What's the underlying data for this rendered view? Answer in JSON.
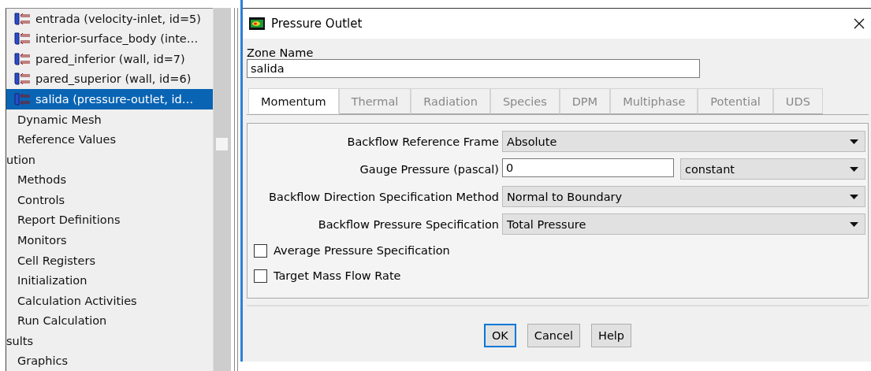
{
  "tree": {
    "items": [
      {
        "label": "entrada (velocity-inlet, id=5)",
        "kind": "zone",
        "selected": false
      },
      {
        "label": "interior-surface_body (inte…",
        "kind": "zone",
        "selected": false
      },
      {
        "label": "pared_inferior (wall, id=7)",
        "kind": "zone",
        "selected": false
      },
      {
        "label": "pared_superior (wall, id=6)",
        "kind": "zone",
        "selected": false
      },
      {
        "label": "salida (pressure-outlet, id…",
        "kind": "zone",
        "selected": true
      },
      {
        "label": "Dynamic Mesh",
        "kind": "item",
        "selected": false
      },
      {
        "label": "Reference Values",
        "kind": "item",
        "selected": false
      },
      {
        "label": "ution",
        "kind": "section",
        "selected": false,
        "children": [
          {
            "label": "Methods",
            "kind": "item",
            "selected": false
          },
          {
            "label": "Controls",
            "kind": "item",
            "selected": false
          },
          {
            "label": "Report Definitions",
            "kind": "item",
            "selected": false
          },
          {
            "label": "Monitors",
            "kind": "item",
            "selected": false
          },
          {
            "label": "Cell Registers",
            "kind": "item",
            "selected": false
          },
          {
            "label": "Initialization",
            "kind": "item",
            "selected": false
          },
          {
            "label": "Calculation Activities",
            "kind": "item",
            "selected": false
          },
          {
            "label": "Run Calculation",
            "kind": "item",
            "selected": false
          }
        ]
      },
      {
        "label": "sults",
        "kind": "section",
        "selected": false,
        "children": [
          {
            "label": "Graphics",
            "kind": "item",
            "selected": false
          }
        ]
      }
    ]
  },
  "dialog": {
    "title": "Pressure Outlet",
    "zone_name_label": "Zone Name",
    "zone_name": "salida",
    "tabs": [
      {
        "label": "Momentum",
        "selected": true
      },
      {
        "label": "Thermal",
        "selected": false
      },
      {
        "label": "Radiation",
        "selected": false
      },
      {
        "label": "Species",
        "selected": false
      },
      {
        "label": "DPM",
        "selected": false
      },
      {
        "label": "Multiphase",
        "selected": false
      },
      {
        "label": "Potential",
        "selected": false
      },
      {
        "label": "UDS",
        "selected": false
      }
    ],
    "fields": [
      {
        "kind": "select",
        "label": "Backflow Reference Frame",
        "value": "Absolute"
      },
      {
        "kind": "input",
        "label": "Gauge Pressure (pascal)",
        "value": "0",
        "mode": "constant"
      },
      {
        "kind": "select",
        "label": "Backflow Direction Specification Method",
        "value": "Normal to Boundary"
      },
      {
        "kind": "select",
        "label": "Backflow Pressure Specification",
        "value": "Total Pressure"
      },
      {
        "kind": "checkbox",
        "label": "Average Pressure Specification",
        "checked": false
      },
      {
        "kind": "checkbox",
        "label": "Target Mass Flow Rate",
        "checked": false
      }
    ],
    "buttons": [
      {
        "label": "OK",
        "selected": true
      },
      {
        "label": "Cancel",
        "selected": false
      },
      {
        "label": "Help",
        "selected": false
      }
    ]
  }
}
